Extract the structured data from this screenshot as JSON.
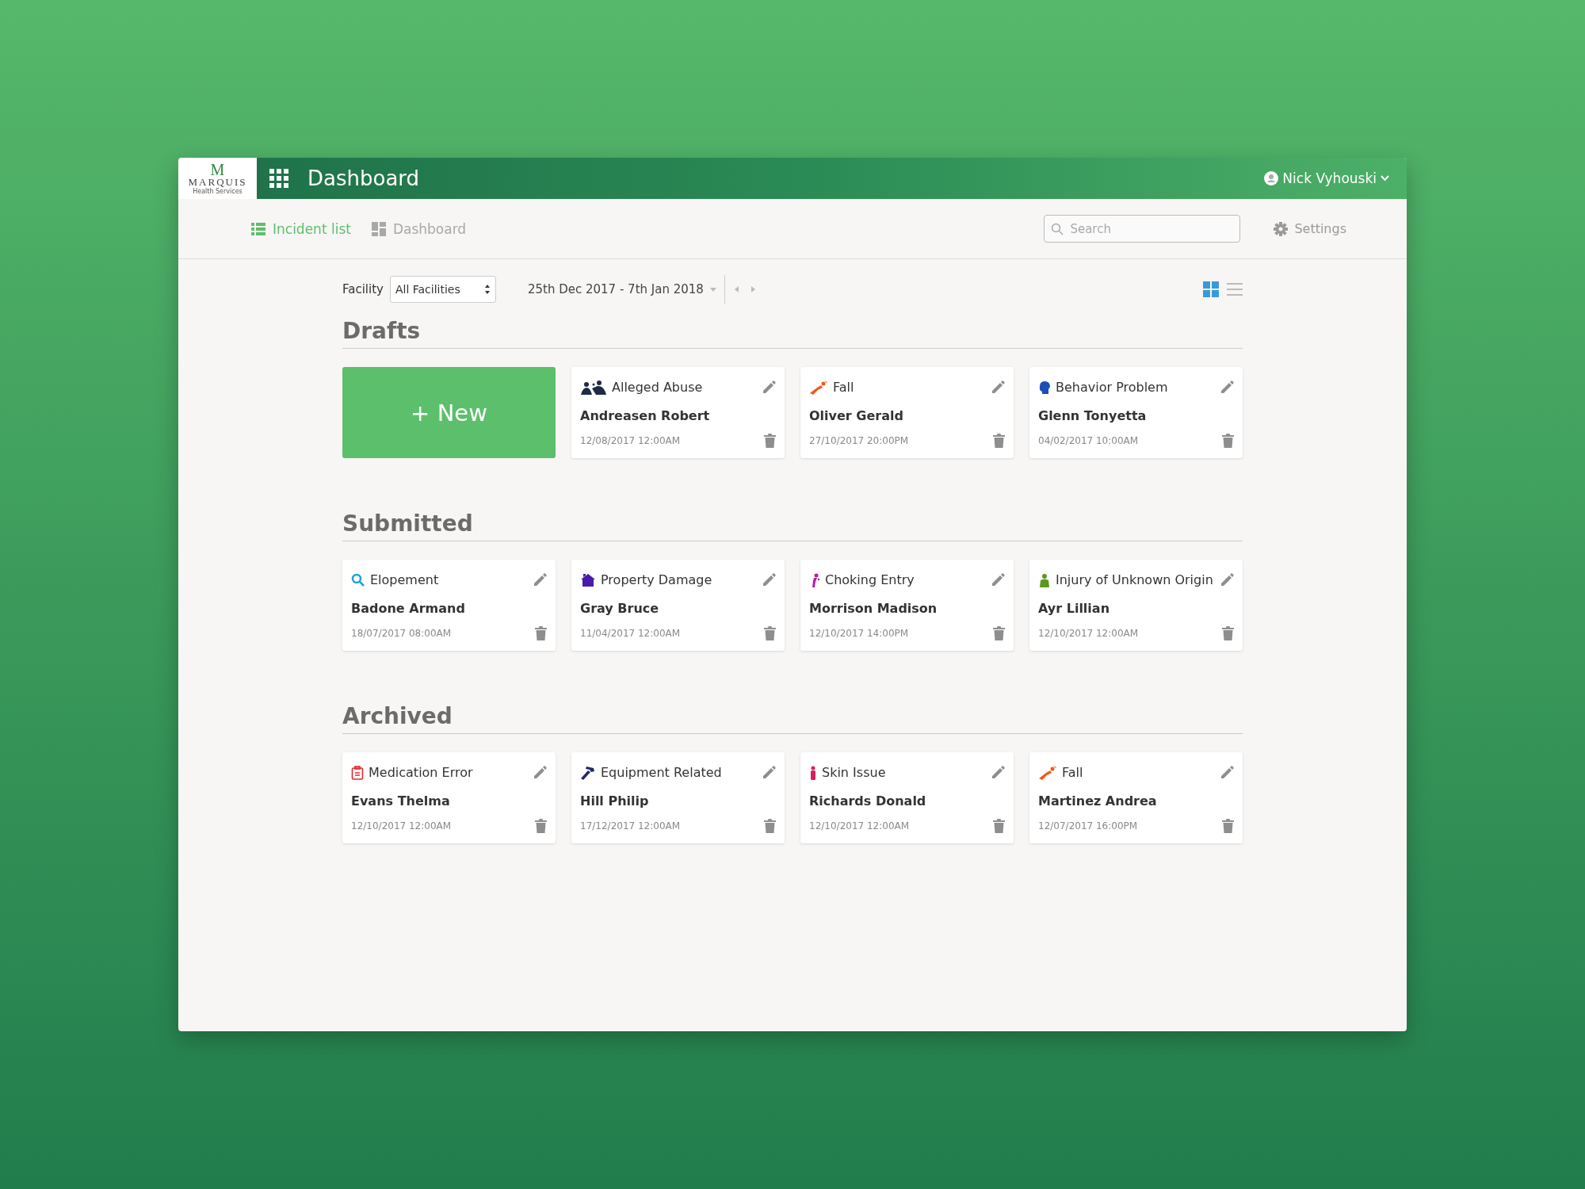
{
  "header": {
    "logo": {
      "mark": "M",
      "name": "MARQUIS",
      "tagline": "Health Services"
    },
    "title": "Dashboard",
    "user": "Nick Vyhouski"
  },
  "nav": {
    "tabs": [
      {
        "label": "Incident list",
        "kind": "list",
        "selected": true
      },
      {
        "label": "Dashboard",
        "kind": "dashboard",
        "selected": false
      }
    ],
    "search": {
      "placeholder": "Search"
    },
    "settings": "Settings"
  },
  "filters": {
    "facility_label": "Facility",
    "facility": "All Facilities",
    "date_range": "25th Dec 2017 - 7th Jan 2018",
    "views": [
      {
        "kind": "grid",
        "selected": true
      },
      {
        "kind": "list",
        "selected": false
      }
    ]
  },
  "sections": [
    {
      "title": "Drafts",
      "new_button": "+ New",
      "cards": [
        {
          "kind": "abuse",
          "color": "#1f2a44",
          "type": "Alleged Abuse",
          "name": "Andreasen Robert",
          "date": "12/08/2017 12:00AM"
        },
        {
          "kind": "fall",
          "color": "#f05a1a",
          "type": "Fall",
          "name": "Oliver Gerald",
          "date": "27/10/2017 20:00PM"
        },
        {
          "kind": "behavior",
          "color": "#1a4fb5",
          "type": "Behavior Problem",
          "name": "Glenn Tonyetta",
          "date": "04/02/2017 10:00AM"
        }
      ]
    },
    {
      "title": "Submitted",
      "cards": [
        {
          "kind": "search",
          "color": "#1ba3d6",
          "type": "Elopement",
          "name": "Badone Armand",
          "date": "18/07/2017 08:00AM"
        },
        {
          "kind": "property",
          "color": "#4a1aa8",
          "type": "Property Damage",
          "name": "Gray Bruce",
          "date": "11/04/2017 12:00AM"
        },
        {
          "kind": "choking",
          "color": "#b21fa8",
          "type": "Choking Entry",
          "name": "Morrison Madison",
          "date": "12/10/2017 14:00PM"
        },
        {
          "kind": "injury",
          "color": "#5a9a1a",
          "type": "Injury of Unknown Origin",
          "name": "Ayr Lillian",
          "date": "12/10/2017 12:00AM"
        }
      ]
    },
    {
      "title": "Archived",
      "cards": [
        {
          "kind": "medication",
          "color": "#e02a2a",
          "type": "Medication Error",
          "name": "Evans Thelma",
          "date": "12/10/2017 12:00AM"
        },
        {
          "kind": "equipment",
          "color": "#1f2a6a",
          "type": "Equipment Related",
          "name": "Hill Philip",
          "date": "17/12/2017 12:00AM"
        },
        {
          "kind": "skin",
          "color": "#d81f5a",
          "type": "Skin Issue",
          "name": "Richards Donald",
          "date": "12/10/2017 12:00AM"
        },
        {
          "kind": "fall",
          "color": "#f05a1a",
          "type": "Fall",
          "name": "Martinez Andrea",
          "date": "12/07/2017 16:00PM"
        }
      ]
    }
  ]
}
